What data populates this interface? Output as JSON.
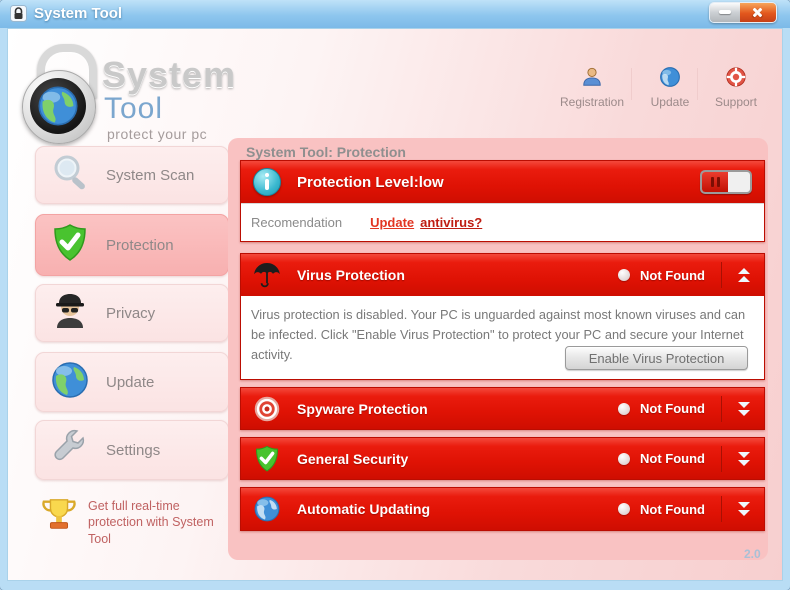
{
  "window": {
    "title": "System Tool",
    "version": "2.0"
  },
  "brand": {
    "line1": "System",
    "line2": "Tool",
    "tagline": "protect your pc"
  },
  "topnav": {
    "items": [
      {
        "label": "Registration",
        "icon": "person-icon"
      },
      {
        "label": "Update",
        "icon": "globe-icon"
      },
      {
        "label": "Support",
        "icon": "lifering-icon"
      }
    ]
  },
  "sidebar": {
    "items": [
      {
        "label": "System Scan",
        "icon": "magnifier-icon",
        "selected": false
      },
      {
        "label": "Protection",
        "icon": "shield-check-icon",
        "selected": true
      },
      {
        "label": "Privacy",
        "icon": "spy-icon",
        "selected": false
      },
      {
        "label": "Update",
        "icon": "globe-icon",
        "selected": false
      },
      {
        "label": "Settings",
        "icon": "wrench-icon",
        "selected": false
      }
    ],
    "promo": "Get full real-time protection with System Tool"
  },
  "main": {
    "header": "System Tool: Protection",
    "protection_level": {
      "label": "Protection Level:low",
      "icon": "info-icon"
    },
    "recommendation": {
      "label": "Recomendation",
      "link1": "Update",
      "link2": "antivirus?"
    },
    "sections": [
      {
        "title": "Virus Protection",
        "status": "Not Found",
        "icon": "umbrella-icon",
        "expanded": true,
        "body": "Virus protection is disabled. Your PC is unguarded against most known viruses and can be infected. Click \"Enable Virus Protection\" to protect your PC and secure your Internet activity.",
        "button": "Enable Virus Protection"
      },
      {
        "title": "Spyware Protection",
        "status": "Not Found",
        "icon": "target-icon",
        "expanded": false
      },
      {
        "title": "General Security",
        "status": "Not Found",
        "icon": "shield-check-icon",
        "expanded": false
      },
      {
        "title": "Automatic Updating",
        "status": "Not Found",
        "icon": "globe-icon",
        "expanded": false
      }
    ]
  },
  "colors": {
    "titlebar_blue": "#8ec6ee",
    "accent_red": "#df1204",
    "panel_pink": "#f9c2c2",
    "link_red": "#e23522",
    "status_white": "#ffffff"
  }
}
